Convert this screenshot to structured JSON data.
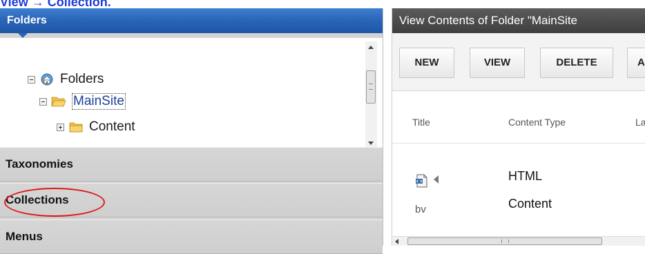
{
  "caption": "View → Collection.",
  "left_panel": {
    "header": "Folders",
    "tree": [
      {
        "label": "Folders",
        "state": "expanded",
        "icon": "home-folder-icon"
      },
      {
        "label": "MainSite",
        "state": "expanded",
        "icon": "open-folder-icon",
        "selected": true
      },
      {
        "label": "Content",
        "state": "collapsed",
        "icon": "folder-icon"
      }
    ],
    "sections": [
      "Taxonomies",
      "Collections",
      "Menus"
    ],
    "highlighted_section": "Collections"
  },
  "right_panel": {
    "title": "View Contents of Folder \"MainSite",
    "toolbar": [
      "NEW",
      "VIEW",
      "DELETE",
      "A"
    ],
    "columns": [
      "Title",
      "Content Type",
      "La"
    ],
    "rows": [
      {
        "title": "bv",
        "content_type_line1": "HTML",
        "content_type_line2": "Content"
      }
    ]
  },
  "colors": {
    "header_blue": "#2b66b8",
    "header_dark": "#4a4a4a",
    "highlight_red": "#e01818",
    "caption_blue": "#1f3cd6"
  }
}
